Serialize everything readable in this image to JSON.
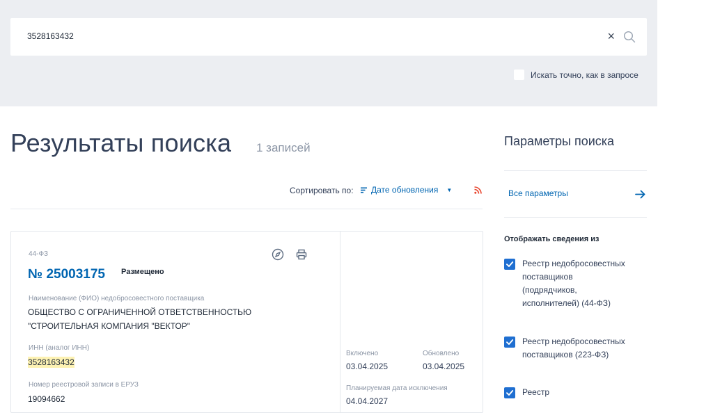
{
  "search": {
    "query": "3528163432",
    "exact_label": "Искать точно, как в запросе",
    "clear_icon": "×"
  },
  "results": {
    "title": "Результаты поиска",
    "count": "1 записей",
    "sort_label": "Сортировать по:",
    "sort_value": "Дате обновления"
  },
  "card": {
    "law": "44-ФЗ",
    "number": "№ 25003175",
    "status": "Размещено",
    "name_label": "Наименование (ФИО) недобросовестного поставщика",
    "name_line1": "ОБЩЕСТВО С ОГРАНИЧЕННОЙ ОТВЕТСТВЕННОСТЬЮ",
    "name_line2": "\"СТРОИТЕЛЬНАЯ КОМПАНИЯ \"ВЕКТОР\"",
    "inn_label": "ИНН (аналог ИНН)",
    "inn": "3528163432",
    "eruz_label": "Номер реестровой записи в ЕРУЗ",
    "eruz": "19094662",
    "included_label": "Включено",
    "included": "03.04.2025",
    "updated_label": "Обновлено",
    "updated": "03.04.2025",
    "planned_label": "Планируемая дата исключения",
    "planned": "04.04.2027"
  },
  "sidebar": {
    "title": "Параметры поиска",
    "all_params": "Все параметры",
    "show_from": "Отображать сведения из",
    "registries": [
      "Реестр недобросовестных поставщиков (подрядчиков, исполнителей) (44-ФЗ)",
      "Реестр недобросовестных поставщиков (223-ФЗ)",
      "Реестр"
    ]
  },
  "colors": {
    "accent": "#0065b1",
    "checkbox": "#1f6fd1",
    "rss": "#e8462f",
    "highlight": "#fdf2b3"
  }
}
